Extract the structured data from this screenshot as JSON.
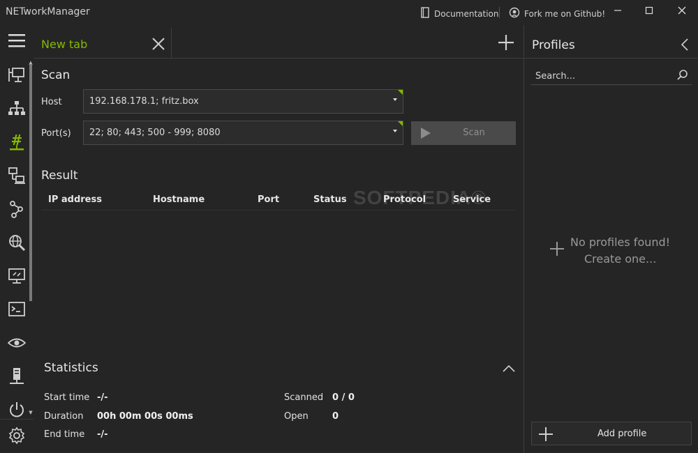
{
  "app": {
    "title": "NETworkManager"
  },
  "titlebar": {
    "documentation_label": "Documentation",
    "github_label": "Fork me on Github!"
  },
  "nav": {
    "items": [
      {
        "icon": "network-interface-icon",
        "active": false
      },
      {
        "icon": "ip-scanner-icon",
        "active": false
      },
      {
        "icon": "port-scanner-icon",
        "active": true
      },
      {
        "icon": "remote-desktop-icon",
        "active": false
      },
      {
        "icon": "traceroute-icon",
        "active": false
      },
      {
        "icon": "dns-lookup-icon",
        "active": false
      },
      {
        "icon": "remote-monitor-icon",
        "active": false
      },
      {
        "icon": "terminal-icon",
        "active": false
      },
      {
        "icon": "watch-eye-icon",
        "active": false
      },
      {
        "icon": "server-icon",
        "active": false
      },
      {
        "icon": "power-icon",
        "active": false
      }
    ],
    "settings_icon": "gear-icon"
  },
  "colors": {
    "accent": "#84b900",
    "background": "#252525",
    "panel_border": "#3d3d3d"
  },
  "tabs": [
    {
      "label": "New tab"
    }
  ],
  "scan": {
    "title": "Scan",
    "host_label": "Host",
    "host_value": "192.168.178.1; fritz.box",
    "ports_label": "Port(s)",
    "ports_value": "22; 80; 443; 500 - 999; 8080",
    "scan_button": "Scan"
  },
  "result": {
    "title": "Result",
    "columns": [
      "IP address",
      "Hostname",
      "Port",
      "Status",
      "Protocol",
      "Service"
    ],
    "rows": []
  },
  "watermark": "SOFTPEDIA®",
  "statistics": {
    "title": "Statistics",
    "start_time_label": "Start time",
    "start_time_value": "-/-",
    "duration_label": "Duration",
    "duration_value": "00h 00m 00s 00ms",
    "end_time_label": "End time",
    "end_time_value": "-/-",
    "scanned_label": "Scanned",
    "scanned_value": "0 / 0",
    "open_label": "Open",
    "open_value": "0"
  },
  "profiles": {
    "title": "Profiles",
    "search_placeholder": "Search...",
    "empty_line1": "No profiles found!",
    "empty_line2": "Create one...",
    "add_label": "Add profile"
  }
}
